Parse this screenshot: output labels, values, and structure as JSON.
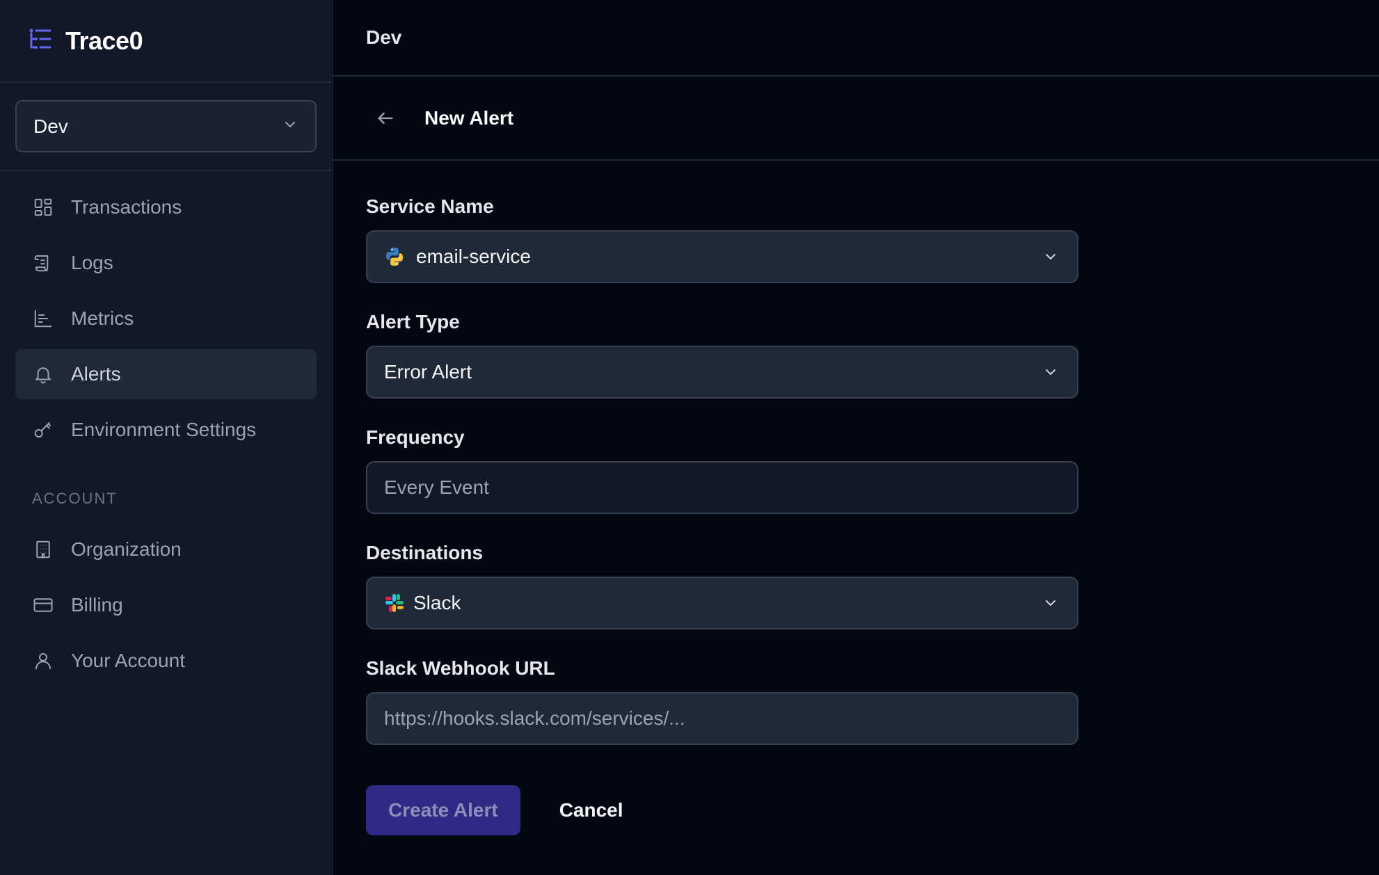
{
  "brand": {
    "name": "Trace0",
    "logo_icon": "list-tree-icon",
    "accent": "#6366f1"
  },
  "sidebar": {
    "environment": {
      "selected": "Dev",
      "icon": "chevron-down-icon"
    },
    "items": [
      {
        "label": "Transactions",
        "icon": "grid-icon",
        "active": false
      },
      {
        "label": "Logs",
        "icon": "scroll-icon",
        "active": false
      },
      {
        "label": "Metrics",
        "icon": "bar-chart-icon",
        "active": false
      },
      {
        "label": "Alerts",
        "icon": "bell-icon",
        "active": true
      },
      {
        "label": "Environment Settings",
        "icon": "key-icon",
        "active": false
      }
    ],
    "account_section": {
      "label": "ACCOUNT",
      "items": [
        {
          "label": "Organization",
          "icon": "building-icon"
        },
        {
          "label": "Billing",
          "icon": "credit-card-icon"
        },
        {
          "label": "Your Account",
          "icon": "user-icon"
        }
      ]
    }
  },
  "header": {
    "title": "Dev"
  },
  "page": {
    "back_icon": "arrow-left-icon",
    "title": "New Alert"
  },
  "form": {
    "service_name": {
      "label": "Service Name",
      "value": "email-service",
      "icon": "python-icon"
    },
    "alert_type": {
      "label": "Alert Type",
      "value": "Error Alert"
    },
    "frequency": {
      "label": "Frequency",
      "placeholder": "Every Event"
    },
    "destinations": {
      "label": "Destinations",
      "value": "Slack",
      "icon": "slack-icon"
    },
    "webhook": {
      "label": "Slack Webhook URL",
      "placeholder": "https://hooks.slack.com/services/..."
    },
    "submit_label": "Create Alert",
    "cancel_label": "Cancel"
  }
}
